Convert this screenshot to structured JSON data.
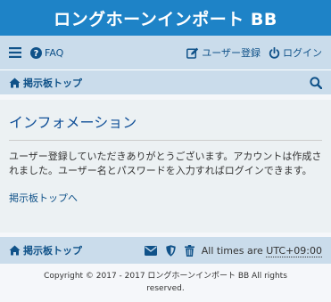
{
  "site": {
    "title": "ロングホーンインポート BB"
  },
  "navbar": {
    "faq_label": "FAQ",
    "register_label": "ユーザー登録",
    "login_label": "ログイン",
    "board_index_label": "掲示板トップ"
  },
  "content": {
    "heading": "インフォメーション",
    "message": "ユーザー登録していただきありがとうございます。アカウントは作成されました。ユーザー名とパスワードを入力すればログインできます。",
    "back_link": "掲示板トップへ"
  },
  "footer": {
    "board_index_label": "掲示板トップ",
    "timezone_prefix": "All times are",
    "timezone_value": "UTC+09:00",
    "copyright": "Copyright © 2017 - 2017 ロングホーンインポート BB All rights reserved."
  },
  "icons": {
    "menu": "hamburger-menu-icon",
    "faq": "question-circle-icon",
    "register": "edit-pencil-icon",
    "login": "power-icon",
    "home": "home-icon",
    "search": "search-icon",
    "contact": "envelope-icon",
    "team": "shield-icon",
    "delete_cookies": "trash-icon"
  },
  "colors": {
    "header_bg": "#1e83c7",
    "navbar_bg": "#cadceb",
    "content_bg": "#ecf1f3",
    "link": "#105289",
    "heading": "#115098"
  }
}
